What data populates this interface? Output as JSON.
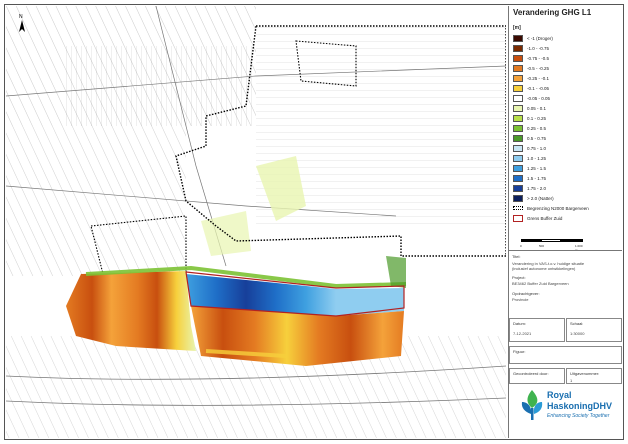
{
  "map": {
    "title": "Verandering GHG L1",
    "unit": "[m]",
    "north_arrow_icon": "north-arrow-icon",
    "legend": [
      {
        "label": "< -1 (Droger)",
        "color": "#3b0a00"
      },
      {
        "label": "-1.0 - -0.75",
        "color": "#7a2a00"
      },
      {
        "label": "-0.75 - -0.5",
        "color": "#c84f0f"
      },
      {
        "label": "-0.5 - -0.25",
        "color": "#e47b22"
      },
      {
        "label": "-0.25 - -0.1",
        "color": "#f4a23a"
      },
      {
        "label": "-0.1 - -0.05",
        "color": "#f7d03c"
      },
      {
        "label": "-0.05 - 0.05",
        "color": "#ffffff"
      },
      {
        "label": "0.05 - 0.1",
        "color": "#e8f5b0"
      },
      {
        "label": "0.1 - 0.25",
        "color": "#b8e04a"
      },
      {
        "label": "0.25 - 0.5",
        "color": "#7cc234"
      },
      {
        "label": "0.5 - 0.75",
        "color": "#4c9a2a"
      },
      {
        "label": "0.75 - 1.0",
        "color": "#c8e6f5"
      },
      {
        "label": "1.0 - 1.25",
        "color": "#8fcdf0"
      },
      {
        "label": "1.25 - 1.5",
        "color": "#3fa0e0"
      },
      {
        "label": "1.5 - 1.75",
        "color": "#1f6fc8"
      },
      {
        "label": "1.75 - 2.0",
        "color": "#173f9a"
      },
      {
        "label": "> 2.0 (Natter)",
        "color": "#0c1f5c"
      },
      {
        "label": "Begrenzing N2000 Bargerveen",
        "type": "dotted"
      },
      {
        "label": "Grens Buffer Zuid",
        "type": "red-outline"
      }
    ],
    "scale": {
      "labels": [
        "0",
        "500",
        "1.000 m"
      ]
    }
  },
  "info": {
    "titel_label": "Titel:",
    "titel_value_line1": "Verandering in VAS-t.o.v. huidige situatie",
    "titel_value_line2": "(inclusief autonome ontwikkelingen)",
    "project_label": "Project:",
    "project_value": "BE3462 Buffer Zuid Bargerveen",
    "opdrachtgever_label": "Opdrachtgever:",
    "opdrachtgever_value": "Provincie",
    "datum_label": "Datum:",
    "datum_value": "7-12-2021",
    "schaal_label": "Schaal:",
    "schaal_value": "1:30000",
    "figuur_label": "Figuur:",
    "gecontroleerd_label": "Gecontroleerd door:",
    "uitgave_label": "Uitgavenummer:",
    "uitgave_value": "1"
  },
  "logo": {
    "line1": "Royal",
    "line2": "HaskoningDHV",
    "tagline": "Enhancing Society Together",
    "icon": "royal-haskoningdhv-logo-icon"
  }
}
